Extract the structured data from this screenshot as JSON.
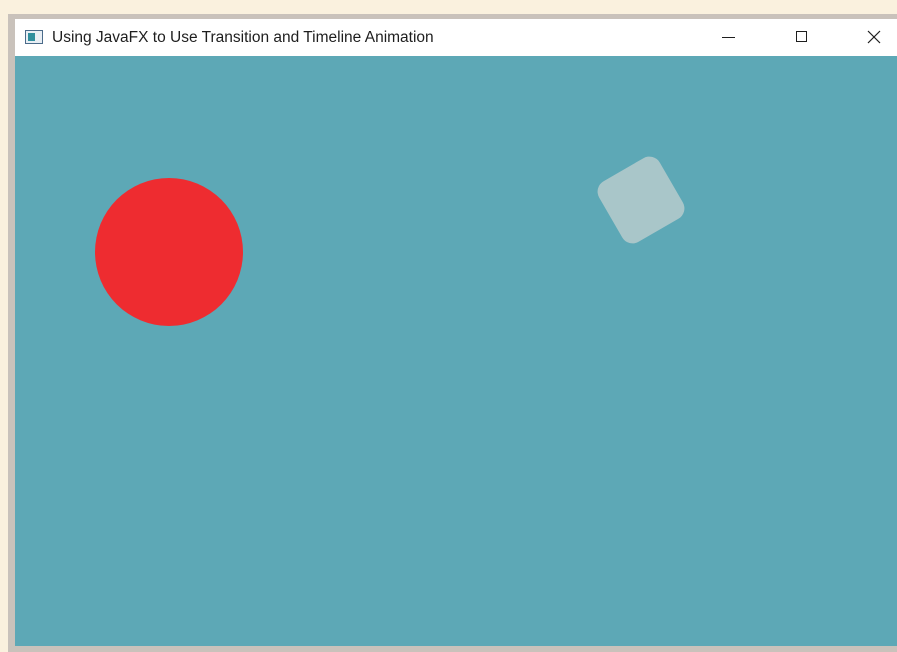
{
  "window": {
    "title": "Using JavaFX to Use Transition and Timeline Animation",
    "controls": {
      "minimize_icon": "minimize-icon",
      "maximize_icon": "maximize-icon",
      "close_icon": "close-icon"
    }
  },
  "scene": {
    "background_color": "#5da8b6",
    "circle": {
      "color": "#ee2c30",
      "shape": "circle"
    },
    "rectangle": {
      "color": "#a9c6c9",
      "shape": "rounded-square",
      "rotation_deg": -30
    }
  }
}
